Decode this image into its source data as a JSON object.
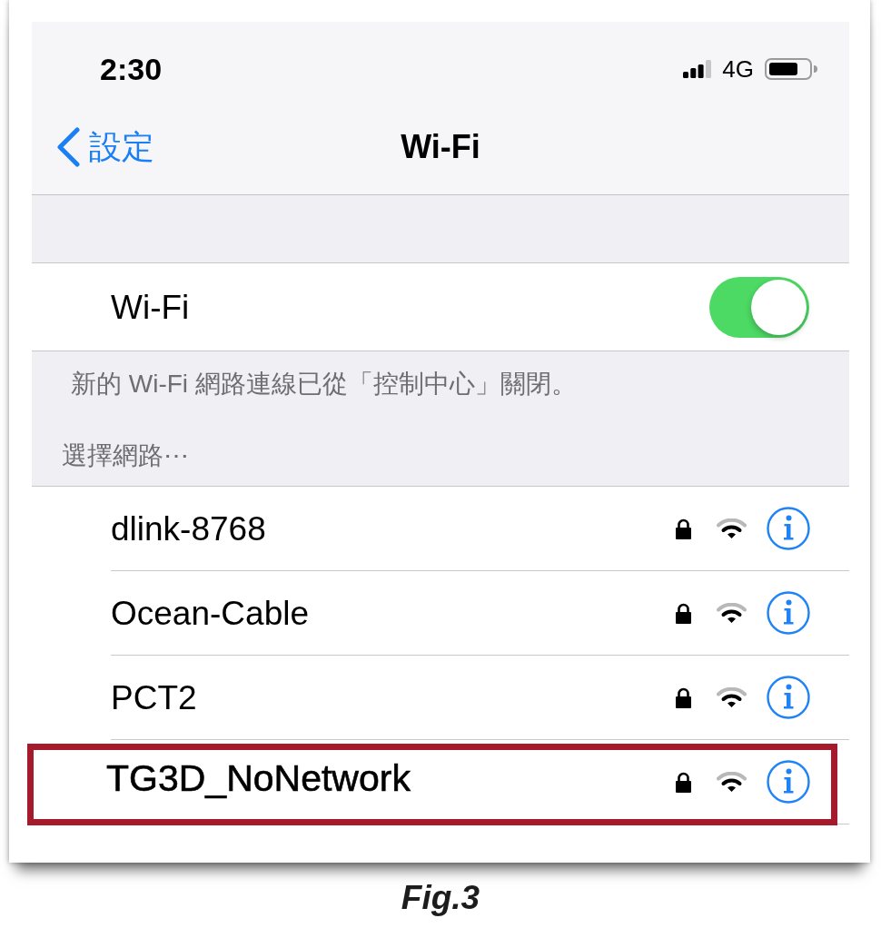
{
  "status_bar": {
    "time": "2:30",
    "network": "4G"
  },
  "nav_bar": {
    "back_label": "設定",
    "title": "Wi-Fi"
  },
  "wifi": {
    "label": "Wi-Fi",
    "on": true
  },
  "notice": "新的 Wi-Fi 網路連線已從「控制中心」關閉。",
  "section_header": "選擇網路⋯",
  "networks": [
    {
      "name": "dlink-8768",
      "secured": true,
      "highlighted": false
    },
    {
      "name": "Ocean-Cable",
      "secured": true,
      "highlighted": false
    },
    {
      "name": "PCT2",
      "secured": true,
      "highlighted": false
    },
    {
      "name": "TG3D_NoNetwork",
      "secured": true,
      "highlighted": true
    }
  ],
  "caption": "Fig.3"
}
